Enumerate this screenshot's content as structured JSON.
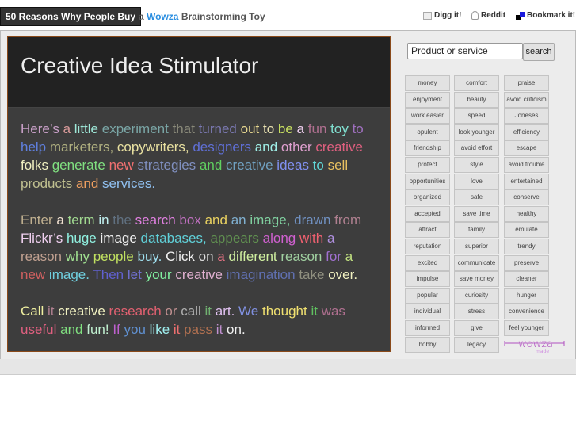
{
  "header": {
    "site_title": "50 Reasons Why People Buy",
    "tagline_pre": "a",
    "tagline_brand": "Wowza",
    "tagline_post": "Brainstorming Toy",
    "links": [
      {
        "label": "Digg it!",
        "icon": "digg-icon"
      },
      {
        "label": "Reddit",
        "icon": "reddit-icon"
      },
      {
        "label": "Bookmark it!",
        "icon": "bookmark-icon"
      }
    ]
  },
  "panel": {
    "title": "Creative Idea Stimulator",
    "paragraphs": [
      [
        [
          "Here’s",
          "#c9a0c8"
        ],
        [
          "a",
          "#d99a9a"
        ],
        [
          "little",
          "#9ee8d8"
        ],
        [
          "experiment",
          "#7aa6a6"
        ],
        [
          "that",
          "#8a8a7a"
        ],
        [
          "turned",
          "#7a78b0"
        ],
        [
          "out",
          "#e8d890"
        ],
        [
          "to",
          "#e8e0b0"
        ],
        [
          "be",
          "#c8e060"
        ],
        [
          "a",
          "#f0d0f0"
        ],
        [
          "fun",
          "#b07090"
        ],
        [
          "toy",
          "#80e0d0"
        ],
        [
          "to",
          "#a070c0"
        ],
        [
          "help",
          "#6080e0"
        ],
        [
          "marketers,",
          "#b0b080"
        ],
        [
          "copywriters,",
          "#e8e0a0"
        ],
        [
          "designers",
          "#6070d8"
        ],
        [
          "and",
          "#a0f0e8"
        ],
        [
          "other",
          "#e0a0d0"
        ],
        [
          "creative",
          "#e06080"
        ],
        [
          "folks",
          "#f0f0c0"
        ],
        [
          "generate",
          "#80e080"
        ],
        [
          "new",
          "#f07070"
        ],
        [
          "strategies",
          "#8090c0"
        ],
        [
          "and",
          "#60d060"
        ],
        [
          "creative",
          "#70a0c0"
        ],
        [
          "ideas",
          "#8090f0"
        ],
        [
          "to",
          "#60d8d8"
        ],
        [
          "sell",
          "#e8c060"
        ],
        [
          "products",
          "#c0c090"
        ],
        [
          "and",
          "#f0a060"
        ],
        [
          "services.",
          "#90c0f0"
        ]
      ],
      [
        [
          "Enter",
          "#c0b090"
        ],
        [
          "a",
          "#f0e0d0"
        ],
        [
          "term",
          "#a0d890"
        ],
        [
          "in",
          "#c0f0f0"
        ],
        [
          "the",
          "#607080"
        ],
        [
          "search",
          "#e080e0"
        ],
        [
          "box",
          "#c070c0"
        ],
        [
          "and",
          "#e8d060"
        ],
        [
          "an",
          "#80b0d0"
        ],
        [
          "image,",
          "#80d0a0"
        ],
        [
          "drawn",
          "#7090c0"
        ],
        [
          "from",
          "#b08090"
        ],
        [
          "Flickr’s",
          "#f0d0f0"
        ],
        [
          "huge",
          "#90f0e0"
        ],
        [
          "image",
          "#f0f0f0"
        ],
        [
          "databases,",
          "#60d0d8"
        ],
        [
          "appears",
          "#609050"
        ],
        [
          "along",
          "#d060d0"
        ],
        [
          "with",
          "#f06070"
        ],
        [
          "a",
          "#b090e0"
        ],
        [
          "reason",
          "#c0a090"
        ],
        [
          "why",
          "#a0e090"
        ],
        [
          "people",
          "#c0e060"
        ],
        [
          "buy.",
          "#a0e0f0"
        ],
        [
          "Click",
          "#f0f0f0"
        ],
        [
          "on",
          "#e0e0e0"
        ],
        [
          "a",
          "#e07080"
        ],
        [
          "different",
          "#d0f0a0"
        ],
        [
          "reason",
          "#a0d0a0"
        ],
        [
          "for",
          "#a070d0"
        ],
        [
          "a",
          "#c0e080"
        ],
        [
          "new",
          "#d06060"
        ],
        [
          "image.",
          "#70d0e0"
        ],
        [
          "Then",
          "#6060d0"
        ],
        [
          "let",
          "#7070d0"
        ],
        [
          "your",
          "#80f0a0"
        ],
        [
          "creative",
          "#e0b0d0"
        ],
        [
          "imagination",
          "#6070b0"
        ],
        [
          "take",
          "#909080"
        ],
        [
          "over.",
          "#f0f0c0"
        ]
      ],
      [
        [
          "Call",
          "#f0f0a0"
        ],
        [
          "it",
          "#b08090"
        ],
        [
          "creative",
          "#f0f0c0"
        ],
        [
          "research",
          "#e06070"
        ],
        [
          "or",
          "#c09090"
        ],
        [
          "call",
          "#b0b0b0"
        ],
        [
          "it",
          "#70b070"
        ],
        [
          "art.",
          "#e0c0f0"
        ],
        [
          "We",
          "#8090e0"
        ],
        [
          "thought",
          "#f0e070"
        ],
        [
          "it",
          "#60c060"
        ],
        [
          "was",
          "#b07090"
        ],
        [
          "useful",
          "#e06080"
        ],
        [
          "and",
          "#80e080"
        ],
        [
          "fun!",
          "#c0f0d0"
        ],
        [
          "If",
          "#c060d0"
        ],
        [
          "you",
          "#6090d0"
        ],
        [
          "like",
          "#a0f0f0"
        ],
        [
          "it",
          "#f07070"
        ],
        [
          "pass",
          "#b07050"
        ],
        [
          "it",
          "#c090d0"
        ],
        [
          "on.",
          "#f0f0f0"
        ]
      ]
    ]
  },
  "search": {
    "value": "Product or service",
    "button_label": "search"
  },
  "reasons": [
    [
      "money",
      "comfort",
      "praise"
    ],
    [
      "enjoyment",
      "beauty",
      "avoid criticism"
    ],
    [
      "work easier",
      "speed",
      "Joneses"
    ],
    [
      "opulent",
      "look younger",
      "efficiency"
    ],
    [
      "friendship",
      "avoid effort",
      "escape"
    ],
    [
      "protect",
      "style",
      "avoid trouble"
    ],
    [
      "opportunities",
      "love",
      "entertained"
    ],
    [
      "organized",
      "safe",
      "conserve"
    ],
    [
      "accepted",
      "save time",
      "healthy"
    ],
    [
      "attract",
      "family",
      "emulate"
    ],
    [
      "reputation",
      "superior",
      "trendy"
    ],
    [
      "excited",
      "communicate",
      "preserve"
    ],
    [
      "impulse",
      "save money",
      "cleaner"
    ],
    [
      "popular",
      "curiosity",
      "hunger"
    ],
    [
      "individual",
      "stress",
      "convenience"
    ],
    [
      "informed",
      "give",
      "feel younger"
    ],
    [
      "hobby",
      "legacy"
    ]
  ],
  "logo": {
    "text": "wowza",
    "sub": "made",
    "color": "#b050c0"
  }
}
